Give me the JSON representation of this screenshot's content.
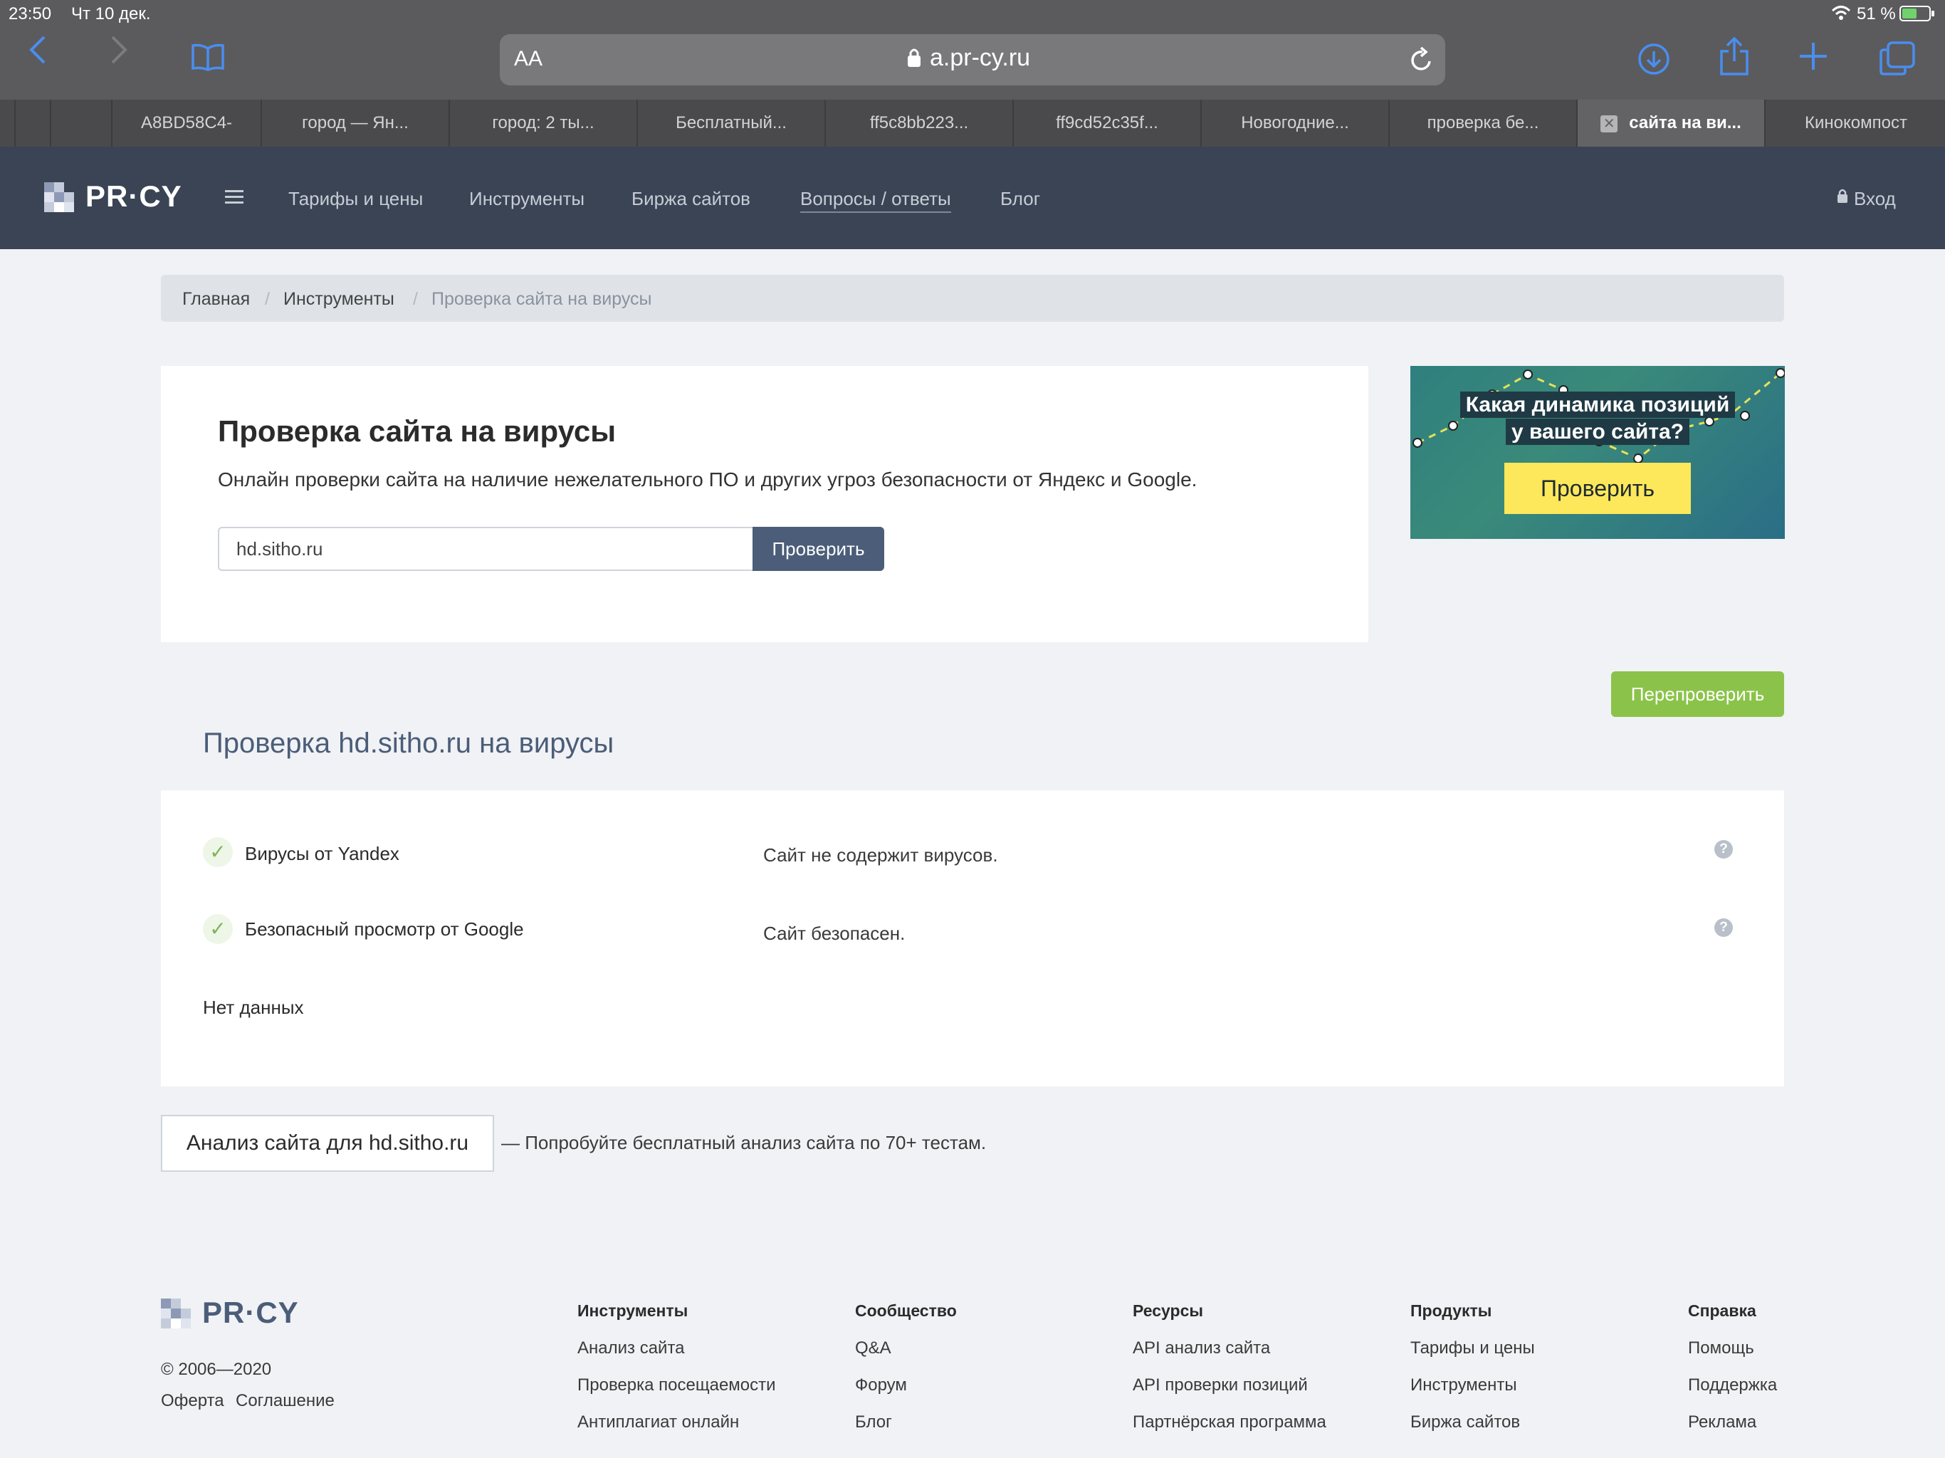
{
  "status": {
    "time": "23:50",
    "date": "Чт 10 дек.",
    "battery": "51 %"
  },
  "browser": {
    "aa": "AA",
    "url": "a.pr-cy.ru",
    "tabs": [
      "A8BD58C4-",
      "город — Ян...",
      "город: 2 ты...",
      "Бесплатный...",
      "ff5c8bb223...",
      "ff9cd52c35f...",
      "Новогодние...",
      "проверка бе...",
      "сайта на ви...",
      "Кинокомпост"
    ]
  },
  "header": {
    "logo": "PR·CY",
    "nav": [
      "Тарифы и цены",
      "Инструменты",
      "Биржа сайтов",
      "Вопросы / ответы",
      "Блог"
    ],
    "login": "Вход"
  },
  "breadcrumb": {
    "home": "Главная",
    "tools": "Инструменты",
    "current": "Проверка сайта на вирусы",
    "sep": "/"
  },
  "main": {
    "title": "Проверка сайта на вирусы",
    "description": "Онлайн проверки сайта на наличие нежелательного ПО и других угроз безопасности от Яндекс и Google.",
    "input_value": "hd.sitho.ru",
    "check_button": "Проверить"
  },
  "banner": {
    "line1": "Какая динамика позиций",
    "line2": "у вашего сайта?",
    "button": "Проверить"
  },
  "recheck_button": "Перепроверить",
  "result": {
    "title": "Проверка hd.sitho.ru на вирусы",
    "rows": [
      {
        "label": "Вирусы от Yandex",
        "value": "Сайт не содержит вирусов."
      },
      {
        "label": "Безопасный просмотр от Google",
        "value": "Сайт безопасен."
      }
    ],
    "no_data": "Нет данных"
  },
  "analysis": {
    "button": "Анализ сайта для hd.sitho.ru",
    "hint": "— Попробуйте бесплатный анализ сайта по 70+ тестам."
  },
  "footer": {
    "logo": "PR·CY",
    "copyright": "© 2006—2020",
    "offer": "Оферта",
    "agreement": "Соглашение",
    "columns": [
      {
        "title": "Инструменты",
        "links": [
          "Анализ сайта",
          "Проверка посещаемости",
          "Антиплагиат онлайн"
        ]
      },
      {
        "title": "Сообщество",
        "links": [
          "Q&A",
          "Форум",
          "Блог"
        ]
      },
      {
        "title": "Ресурсы",
        "links": [
          "API анализ сайта",
          "API проверки позиций",
          "Партнёрская программа"
        ]
      },
      {
        "title": "Продукты",
        "links": [
          "Тарифы и цены",
          "Инструменты",
          "Биржа сайтов"
        ]
      },
      {
        "title": "Справка",
        "links": [
          "Помощь",
          "Поддержка",
          "Реклама"
        ]
      }
    ]
  },
  "colors": {
    "header_bg": "#3a4455",
    "accent_button": "#4b5d78",
    "recheck_green": "#8bc34a",
    "banner_yellow": "#fce85a"
  }
}
